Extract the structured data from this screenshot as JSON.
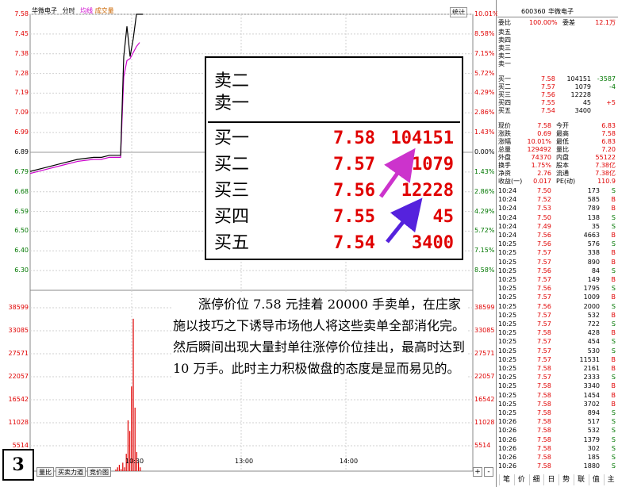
{
  "chart": {
    "stock_name": "华微电子",
    "tab_time": "分时",
    "tab_avg": "均线",
    "tab_vol": "成交量",
    "stat_button": "统计",
    "y_prices": [
      "7.58",
      "7.45",
      "7.38",
      "7.28",
      "7.19",
      "7.09",
      "6.99",
      "6.89",
      "6.79",
      "6.68",
      "6.59",
      "6.50",
      "6.40",
      "6.30"
    ],
    "y_pcts": [
      "10.01%",
      "8.58%",
      "7.15%",
      "5.72%",
      "4.29%",
      "2.86%",
      "1.43%",
      "0.00%",
      "1.43%",
      "2.86%",
      "4.29%",
      "5.72%",
      "7.15%",
      "8.58%"
    ],
    "vol_ticks_left": [
      "38599",
      "33085",
      "27571",
      "22057",
      "16542",
      "11028",
      "5514"
    ],
    "vol_ticks_right": [
      "38599",
      "33085",
      "27571",
      "22057",
      "16542",
      "11028",
      "5514"
    ],
    "time_ticks": [
      "10:30",
      "13:00",
      "14:00"
    ],
    "bottom_tabs": [
      "量比",
      "买卖力道",
      "竞价图"
    ],
    "zoom_plus": "+",
    "zoom_minus": "-"
  },
  "chart_data": {
    "type": "line",
    "title": "",
    "series": [
      {
        "name": "price",
        "color": "#000000",
        "x": [
          0,
          20,
          40,
          60,
          80,
          90,
          100,
          110,
          114,
          118,
          122,
          126,
          130,
          134,
          138,
          142
        ],
        "values": [
          6.8,
          6.82,
          6.84,
          6.86,
          6.87,
          6.87,
          6.88,
          6.88,
          6.88,
          7.37,
          7.52,
          7.37,
          7.46,
          7.58,
          7.58,
          7.58
        ]
      },
      {
        "name": "average",
        "color": "#cc00cc",
        "x": [
          0,
          20,
          40,
          60,
          80,
          90,
          100,
          110,
          114,
          118,
          122,
          126,
          130,
          134,
          138
        ],
        "values": [
          6.79,
          6.81,
          6.83,
          6.85,
          6.86,
          6.86,
          6.87,
          6.87,
          6.87,
          7.27,
          7.35,
          7.36,
          7.39,
          7.42,
          7.44
        ]
      }
    ],
    "volume": [
      400,
      900,
      1500,
      500,
      2000,
      900,
      4100,
      12000,
      9500,
      20000,
      36000,
      15000,
      4500,
      2100,
      900
    ],
    "ylim": [
      6.21,
      7.58
    ],
    "vol_max": 38599
  },
  "quote": {
    "code": "600360",
    "name": "华微电子",
    "weibi_label": "委比",
    "weibi_value": "100.00%",
    "weicha_label": "委差",
    "weicha_value": "12.1万",
    "sells": [
      {
        "label": "卖五",
        "price": "",
        "vol": "",
        "chg": ""
      },
      {
        "label": "卖四",
        "price": "",
        "vol": "",
        "chg": ""
      },
      {
        "label": "卖三",
        "price": "",
        "vol": "",
        "chg": ""
      },
      {
        "label": "卖二",
        "price": "",
        "vol": "",
        "chg": ""
      },
      {
        "label": "卖一",
        "price": "",
        "vol": "",
        "chg": ""
      }
    ],
    "buys": [
      {
        "label": "买一",
        "price": "7.58",
        "vol": "104151",
        "chg": "-3587"
      },
      {
        "label": "买二",
        "price": "7.57",
        "vol": "1079",
        "chg": "-4"
      },
      {
        "label": "买三",
        "price": "7.56",
        "vol": "12228",
        "chg": ""
      },
      {
        "label": "买四",
        "price": "7.55",
        "vol": "45",
        "chg": "+5"
      },
      {
        "label": "买五",
        "price": "7.54",
        "vol": "3400",
        "chg": ""
      }
    ],
    "stats": [
      [
        "现价",
        "7.58",
        "今开",
        "6.83"
      ],
      [
        "涨跌",
        "0.69",
        "最高",
        "7.58"
      ],
      [
        "涨幅",
        "10.01%",
        "最低",
        "6.83"
      ],
      [
        "总量",
        "129492",
        "量比",
        "7.20"
      ],
      [
        "外盘",
        "74370",
        "内盘",
        "55122"
      ],
      [
        "换手",
        "1.75%",
        "股本",
        "7.38亿"
      ],
      [
        "净资",
        "2.76",
        "流通",
        "7.38亿"
      ],
      [
        "收益(一)",
        "0.017",
        "PE(动)",
        "110.9"
      ]
    ],
    "ticks": [
      [
        "10:24",
        "7.50",
        "173",
        "S"
      ],
      [
        "10:24",
        "7.52",
        "585",
        "B"
      ],
      [
        "10:24",
        "7.53",
        "789",
        "B"
      ],
      [
        "10:24",
        "7.50",
        "138",
        "S"
      ],
      [
        "10:24",
        "7.49",
        "35",
        "S"
      ],
      [
        "10:24",
        "7.56",
        "4663",
        "B"
      ],
      [
        "10:25",
        "7.56",
        "576",
        "S"
      ],
      [
        "10:25",
        "7.57",
        "338",
        "B"
      ],
      [
        "10:25",
        "7.57",
        "890",
        "B"
      ],
      [
        "10:25",
        "7.56",
        "84",
        "S"
      ],
      [
        "10:25",
        "7.57",
        "149",
        "B"
      ],
      [
        "10:25",
        "7.56",
        "1795",
        "S"
      ],
      [
        "10:25",
        "7.57",
        "1009",
        "B"
      ],
      [
        "10:25",
        "7.56",
        "2000",
        "S"
      ],
      [
        "10:25",
        "7.57",
        "532",
        "B"
      ],
      [
        "10:25",
        "7.57",
        "722",
        "S"
      ],
      [
        "10:25",
        "7.58",
        "428",
        "B"
      ],
      [
        "10:25",
        "7.57",
        "454",
        "S"
      ],
      [
        "10:25",
        "7.57",
        "530",
        "S"
      ],
      [
        "10:25",
        "7.57",
        "11531",
        "B"
      ],
      [
        "10:25",
        "7.58",
        "2161",
        "B"
      ],
      [
        "10:25",
        "7.57",
        "2333",
        "S"
      ],
      [
        "10:25",
        "7.58",
        "3340",
        "B"
      ],
      [
        "10:25",
        "7.58",
        "1454",
        "B"
      ],
      [
        "10:25",
        "7.58",
        "3702",
        "B"
      ],
      [
        "10:25",
        "7.58",
        "894",
        "S"
      ],
      [
        "10:26",
        "7.58",
        "517",
        "S"
      ],
      [
        "10:26",
        "7.58",
        "532",
        "S"
      ],
      [
        "10:26",
        "7.58",
        "1379",
        "S"
      ],
      [
        "10:26",
        "7.58",
        "302",
        "S"
      ],
      [
        "10:26",
        "7.58",
        "185",
        "S"
      ],
      [
        "10:26",
        "7.58",
        "1880",
        "S"
      ]
    ],
    "bottom_tabs": [
      "笔",
      "价",
      "细",
      "日",
      "势",
      "联",
      "值",
      "主"
    ]
  },
  "overlay": {
    "sells": [
      {
        "label": "卖二"
      },
      {
        "label": "卖一"
      }
    ],
    "buys": [
      {
        "label": "买一",
        "price": "7.58",
        "vol": "104151"
      },
      {
        "label": "买二",
        "price": "7.57",
        "vol": "1079"
      },
      {
        "label": "买三",
        "price": "7.56",
        "vol": "12228"
      },
      {
        "label": "买四",
        "price": "7.55",
        "vol": "45"
      },
      {
        "label": "买五",
        "price": "7.54",
        "vol": "3400"
      }
    ]
  },
  "annotation": "涨停价位 7.58 元挂着 20000 手卖单，在庄家施以技巧之下诱导市场他人将这些卖单全部消化完。然后瞬间出现大量封单往涨停价位挂出，最高时达到 10 万手。此时主力积极做盘的态度是显而易见的。",
  "page_number": "3",
  "colors": {
    "up": "#e00000",
    "down": "#007700",
    "avg_line": "#cc00cc",
    "arrow": "#cc33cc",
    "arrow2": "#5522dd"
  }
}
